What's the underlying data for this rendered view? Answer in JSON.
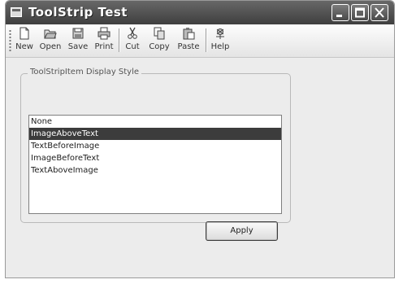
{
  "window": {
    "title": "ToolStrip Test"
  },
  "toolbar": {
    "buttons": [
      {
        "label": "New",
        "icon": "new-file-icon"
      },
      {
        "label": "Open",
        "icon": "open-folder-icon"
      },
      {
        "label": "Save",
        "icon": "save-icon"
      },
      {
        "label": "Print",
        "icon": "print-icon"
      },
      {
        "label": "Cut",
        "icon": "cut-icon"
      },
      {
        "label": "Copy",
        "icon": "copy-icon"
      },
      {
        "label": "Paste",
        "icon": "paste-icon"
      },
      {
        "label": "Help",
        "icon": "help-icon"
      }
    ]
  },
  "display_group": {
    "title": "ToolStripItem Display Style",
    "items": [
      "None",
      "ImageAboveText",
      "TextBeforeImage",
      "ImageBeforeText",
      "TextAboveImage"
    ],
    "selected": "ImageAboveText"
  },
  "apply_button": {
    "label": "Apply"
  }
}
